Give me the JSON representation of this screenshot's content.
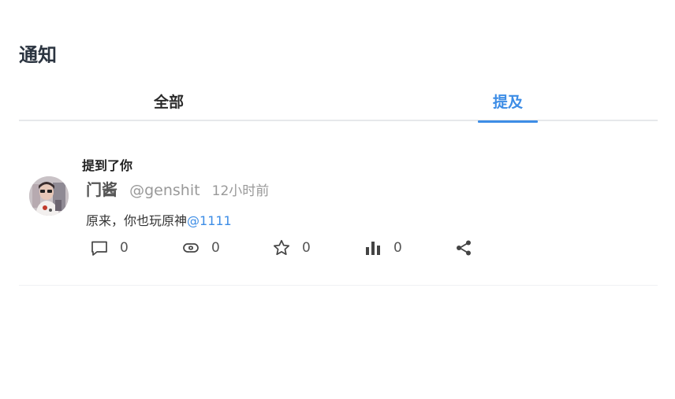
{
  "page": {
    "title": "通知"
  },
  "tabs": [
    {
      "label": "全部",
      "active": false
    },
    {
      "label": "提及",
      "active": true
    }
  ],
  "colors": {
    "accent": "#3d8de6",
    "title": "#2b3440"
  },
  "notification": {
    "type_label": "提到了你",
    "user": {
      "display_name": "门酱",
      "handle": "@genshit",
      "avatar_icon": "avatar-photo"
    },
    "time": "12小时前",
    "content_text": "原来，你也玩原神",
    "mention": "@1111",
    "actions": {
      "reply": {
        "icon": "comment-icon",
        "count": "0"
      },
      "repost": {
        "icon": "repost-icon",
        "count": "0"
      },
      "like": {
        "icon": "star-icon",
        "count": "0"
      },
      "views": {
        "icon": "bar-chart-icon",
        "count": "0"
      },
      "share": {
        "icon": "share-icon"
      }
    }
  }
}
